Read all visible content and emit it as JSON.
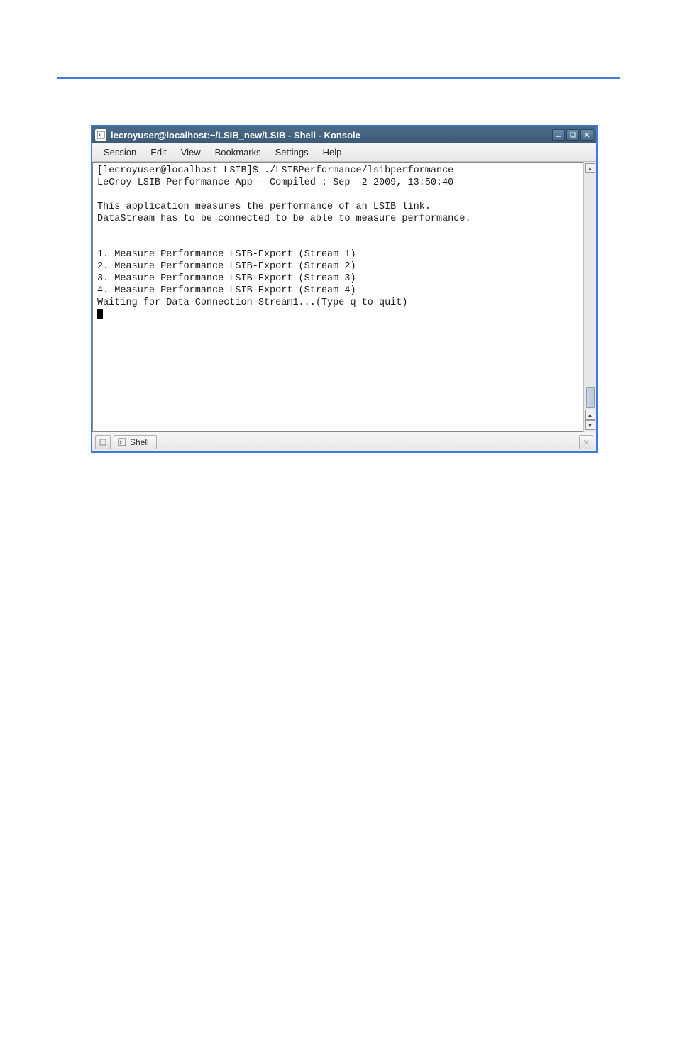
{
  "window": {
    "title": "lecroyuser@localhost:~/LSIB_new/LSIB - Shell - Konsole"
  },
  "menubar": {
    "items": [
      {
        "label": "Session"
      },
      {
        "label": "Edit"
      },
      {
        "label": "View"
      },
      {
        "label": "Bookmarks"
      },
      {
        "label": "Settings"
      },
      {
        "label": "Help"
      }
    ]
  },
  "terminal": {
    "line1": "[lecroyuser@localhost LSIB]$ ./LSIBPerformance/lsibperformance",
    "line2": "LeCroy LSIB Performance App - Compiled : Sep  2 2009, 13:50:40",
    "line3": "",
    "line4": "This application measures the performance of an LSIB link.",
    "line5": "DataStream has to be connected to be able to measure performance.",
    "line6": "",
    "line7": "",
    "line8": "1. Measure Performance LSIB-Export (Stream 1)",
    "line9": "2. Measure Performance LSIB-Export (Stream 2)",
    "line10": "3. Measure Performance LSIB-Export (Stream 3)",
    "line11": "4. Measure Performance LSIB-Export (Stream 4)",
    "line12": "Waiting for Data Connection-Stream1...(Type q to quit)"
  },
  "tabs": {
    "shell_label": "Shell"
  }
}
